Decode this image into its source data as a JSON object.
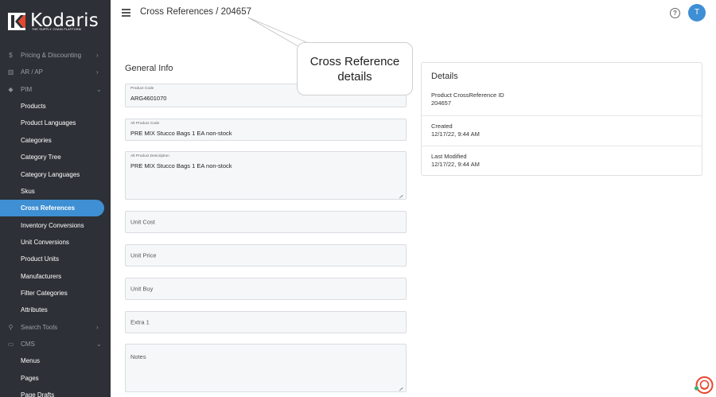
{
  "brand": {
    "name": "Kodaris",
    "tagline": "THE SUPPLY CHAIN PLATFORM",
    "mark_color": "#ffffff",
    "accent_color": "#e8452e"
  },
  "sidebar": {
    "bg_color": "#2d3036",
    "active_color": "#3e8fd4",
    "items": [
      {
        "label": "Pricing & Discounting",
        "icon": "dollar-icon",
        "glyph": "$",
        "type": "section",
        "chevron": "›"
      },
      {
        "label": "AR / AP",
        "icon": "bank-icon",
        "glyph": "▥",
        "type": "section",
        "chevron": "›"
      },
      {
        "label": "PIM",
        "icon": "tag-icon",
        "glyph": "◆",
        "type": "section",
        "chevron": "⌄"
      },
      {
        "label": "Products",
        "type": "sub"
      },
      {
        "label": "Product Languages",
        "type": "sub"
      },
      {
        "label": "Categories",
        "type": "sub"
      },
      {
        "label": "Category Tree",
        "type": "sub"
      },
      {
        "label": "Category Languages",
        "type": "sub"
      },
      {
        "label": "Skus",
        "type": "sub"
      },
      {
        "label": "Cross References",
        "type": "sub",
        "active": true
      },
      {
        "label": "Inventory Conversions",
        "type": "sub"
      },
      {
        "label": "Unit Conversions",
        "type": "sub"
      },
      {
        "label": "Product Units",
        "type": "sub"
      },
      {
        "label": "Manufacturers",
        "type": "sub"
      },
      {
        "label": "Filter Categories",
        "type": "sub"
      },
      {
        "label": "Attributes",
        "type": "sub"
      },
      {
        "label": "Search Tools",
        "icon": "search-icon",
        "glyph": "⚲",
        "type": "section",
        "chevron": "›"
      },
      {
        "label": "CMS",
        "icon": "monitor-icon",
        "glyph": "▭",
        "type": "section",
        "chevron": "⌄"
      },
      {
        "label": "Menus",
        "type": "sub"
      },
      {
        "label": "Pages",
        "type": "sub"
      },
      {
        "label": "Page Drafts",
        "type": "sub"
      }
    ]
  },
  "header": {
    "title": "Cross References / 204657",
    "help_glyph": "?",
    "avatar_initial": "T",
    "avatar_color": "#3e8fd4"
  },
  "general_info": {
    "title": "General Info",
    "product_code": {
      "label": "Product Code",
      "value": "ARG4601070"
    },
    "alt_product_code": {
      "label": "Alt Product Code",
      "value": "PRE MIX  Stucco Bags 1 EA non-stock"
    },
    "alt_product_description": {
      "label": "Alt Product Description",
      "value": "PRE MIX  Stucco Bags 1 EA non-stock"
    },
    "unit_cost": {
      "placeholder": "Unit Cost"
    },
    "unit_price": {
      "placeholder": "Unit Price"
    },
    "unit_buy": {
      "placeholder": "Unit Buy"
    },
    "extra1": {
      "placeholder": "Extra 1"
    },
    "notes": {
      "placeholder": "Notes"
    }
  },
  "details": {
    "title": "Details",
    "rows": [
      {
        "label": "Product CrossReference ID",
        "value": "204657"
      },
      {
        "label": "Created",
        "value": "12/17/22, 9:44 AM"
      },
      {
        "label": "Last Modified",
        "value": "12/17/22, 9:44 AM"
      }
    ]
  },
  "callout": {
    "line1": "Cross Reference",
    "line2": "details"
  },
  "chat": {
    "icon": "chat-support-icon",
    "color": "#e8452e",
    "status_color": "#3cb371"
  }
}
